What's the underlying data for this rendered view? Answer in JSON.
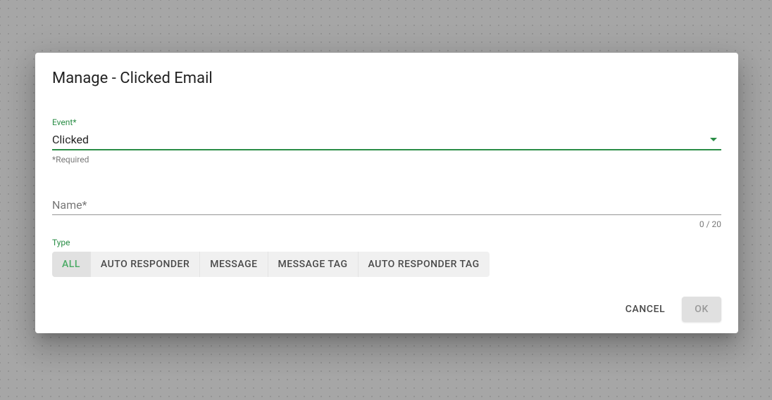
{
  "dialog": {
    "title": "Manage - Clicked Email"
  },
  "event": {
    "label": "Event*",
    "value": "Clicked",
    "helper": "*Required"
  },
  "name": {
    "placeholder": "Name*",
    "counter": "0 / 20"
  },
  "type": {
    "label": "Type",
    "options": [
      "ALL",
      "AUTO RESPONDER",
      "MESSAGE",
      "MESSAGE TAG",
      "AUTO RESPONDER TAG"
    ],
    "selected_index": 0
  },
  "actions": {
    "cancel": "CANCEL",
    "ok": "OK"
  }
}
